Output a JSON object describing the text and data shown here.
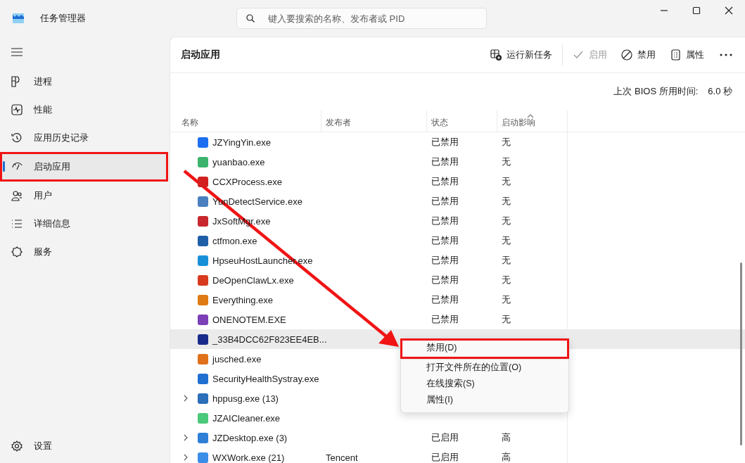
{
  "window": {
    "title": "任务管理器"
  },
  "search": {
    "placeholder": "键入要搜索的名称、发布者或 PID"
  },
  "sidebar": {
    "items": [
      {
        "label": "进程",
        "selected": false,
        "outlined": false
      },
      {
        "label": "性能",
        "selected": false,
        "outlined": false
      },
      {
        "label": "应用历史记录",
        "selected": false,
        "outlined": false
      },
      {
        "label": "启动应用",
        "selected": true,
        "outlined": true
      },
      {
        "label": "用户",
        "selected": false,
        "outlined": false
      },
      {
        "label": "详细信息",
        "selected": false,
        "outlined": false
      },
      {
        "label": "服务",
        "selected": false,
        "outlined": false
      }
    ],
    "footer": {
      "label": "设置"
    }
  },
  "page": {
    "title": "启动应用",
    "toolbar": [
      {
        "label": "运行新任务",
        "disabled": false
      },
      {
        "label": "启用",
        "disabled": true
      },
      {
        "label": "禁用",
        "disabled": false
      },
      {
        "label": "属性",
        "disabled": false
      }
    ],
    "bios": {
      "label": "上次 BIOS 所用时间:",
      "value": "6.0 秒"
    }
  },
  "table": {
    "columns": [
      {
        "label": "名称",
        "sorted": false
      },
      {
        "label": "发布者",
        "sorted": false
      },
      {
        "label": "状态",
        "sorted": false
      },
      {
        "label": "启动影响",
        "sorted": true
      }
    ],
    "rows": [
      {
        "kind": "app",
        "name": "JZYingYin.exe",
        "status": "已禁用",
        "impact": "无",
        "hovered": false
      },
      {
        "kind": "app",
        "name": "yuanbao.exe",
        "status": "已禁用",
        "impact": "无",
        "hovered": false
      },
      {
        "kind": "app",
        "name": "CCXProcess.exe",
        "status": "已禁用",
        "impact": "无",
        "hovered": false
      },
      {
        "kind": "app",
        "name": "YunDetectService.exe",
        "status": "已禁用",
        "impact": "无",
        "hovered": false
      },
      {
        "kind": "app",
        "name": "JxSoftMgr.exe",
        "status": "已禁用",
        "impact": "无",
        "hovered": false
      },
      {
        "kind": "app",
        "name": "ctfmon.exe",
        "status": "已禁用",
        "impact": "无",
        "hovered": false
      },
      {
        "kind": "app",
        "name": "HpseuHostLauncher.exe",
        "status": "已禁用",
        "impact": "无",
        "hovered": false
      },
      {
        "kind": "app",
        "name": "DeOpenClawLx.exe",
        "status": "已禁用",
        "impact": "无",
        "hovered": false
      },
      {
        "kind": "app",
        "name": "Everything.exe",
        "status": "已禁用",
        "impact": "无",
        "hovered": false
      },
      {
        "kind": "app",
        "name": "ONENOTEM.EXE",
        "status": "已禁用",
        "impact": "无",
        "hovered": false
      },
      {
        "kind": "app",
        "name": "_33B4DCC62F823EE4EB...",
        "hovered": true
      },
      {
        "kind": "app",
        "name": "jusched.exe",
        "hovered": false
      },
      {
        "kind": "app",
        "name": "SecurityHealthSystray.exe",
        "hovered": false
      },
      {
        "kind": "group",
        "name": "hppusg.exe (13)",
        "hovered": false
      },
      {
        "kind": "app",
        "name": "JZAICleaner.exe",
        "hovered": false
      },
      {
        "kind": "group",
        "name": "JZDesktop.exe (3)",
        "status": "已启用",
        "impact": "高",
        "hovered": false
      },
      {
        "kind": "group",
        "name": "WXWork.exe (21)",
        "publisher": "Tencent",
        "status": "已启用",
        "impact": "高",
        "hovered": false
      }
    ]
  },
  "context_menu": {
    "items": [
      {
        "label": "禁用(D)",
        "separator_after": true,
        "outlined": true
      },
      {
        "label": "打开文件所在的位置(O)",
        "separator_after": false,
        "outlined": false
      },
      {
        "label": "在线搜索(S)",
        "separator_after": false,
        "outlined": false
      },
      {
        "label": "属性(I)",
        "separator_after": false,
        "outlined": false
      }
    ]
  }
}
